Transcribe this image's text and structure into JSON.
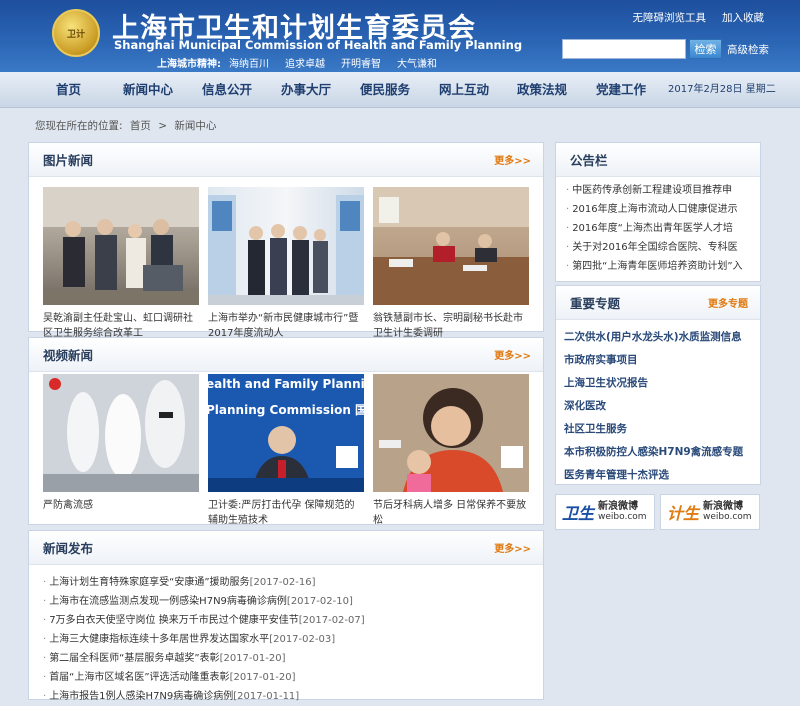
{
  "header": {
    "emblem_text": "卫计",
    "title_cn": "上海市卫生和计划生育委员会",
    "title_en": "Shanghai Municipal Commission of Health and Family Planning",
    "spirit_label": "上海城市精神:",
    "spirit_words": [
      "海纳百川",
      "追求卓越",
      "开明睿智",
      "大气谦和"
    ],
    "top_links": [
      "无障碍浏览工具",
      "加入收藏"
    ],
    "search_placeholder": "",
    "search_button": "检索",
    "advanced_search": "高级检索"
  },
  "nav": {
    "items": [
      "首页",
      "新闻中心",
      "信息公开",
      "办事大厅",
      "便民服务",
      "网上互动",
      "政策法规",
      "党建工作"
    ],
    "date": "2017年2月28日 星期二"
  },
  "breadcrumb": {
    "prefix": "您现在所在的位置:",
    "home": "首页",
    "sep": ">",
    "current": "新闻中心"
  },
  "picture_news": {
    "title": "图片新闻",
    "more": "更多>>",
    "items": [
      {
        "caption": "吴乾渝副主任赴宝山、虹口调研社区卫生服务综合改革工"
      },
      {
        "caption": "上海市举办“新市民健康城市行”暨2017年度流动人"
      },
      {
        "caption": "翁铁慧副市长、宗明副秘书长赴市卫生计生委调研"
      }
    ]
  },
  "video_news": {
    "title": "视频新闻",
    "more": "更多>>",
    "items": [
      {
        "caption": "严防禽流感"
      },
      {
        "caption": "卫计委:严厉打击代孕 保障规范的辅助生殖技术",
        "thumb_text_1": "ealth and Family Planning Co",
        "thumb_text_2": "Planning Commission 国家"
      },
      {
        "caption": "节后牙科病人增多 日常保养不要放松"
      }
    ]
  },
  "news_release": {
    "title": "新闻发布",
    "more": "更多>>",
    "items": [
      {
        "text": "上海计划生育特殊家庭享受“安康通”援助服务",
        "date": "[2017-02-16]"
      },
      {
        "text": "上海市在流感监测点发现一例感染H7N9病毒确诊病例",
        "date": "[2017-02-10]"
      },
      {
        "text": "7万多白衣天使坚守岗位 换来万千市民过个健康平安佳节",
        "date": "[2017-02-07]"
      },
      {
        "text": "上海三大健康指标连续十多年居世界发达国家水平",
        "date": "[2017-02-03]"
      },
      {
        "text": "第二届全科医师“基层服务卓越奖”表彰",
        "date": "[2017-01-20]"
      },
      {
        "text": "首届“上海市区域名医”评选活动隆重表彰",
        "date": "[2017-01-20]"
      },
      {
        "text": "上海市报告1例人感染H7N9病毒确诊病例",
        "date": "[2017-01-11]"
      }
    ]
  },
  "notice": {
    "title": "公告栏",
    "items": [
      "中医药传承创新工程建设项目推荐申",
      "2016年度上海市流动人口健康促进示",
      "2016年度“上海杰出青年医学人才培",
      "关于对2016年全国综合医院、专科医",
      "第四批“上海青年医师培养资助计划”入"
    ]
  },
  "topics": {
    "title": "重要专题",
    "more": "更多专题",
    "items": [
      "二次供水(用户水龙头水)水质监测信息",
      "市政府实事项目",
      "上海卫生状况报告",
      "深化医改",
      "社区卫生服务",
      "本市积极防控人感染H7N9禽流感专题",
      "医务青年管理十杰评选"
    ]
  },
  "weibo": [
    {
      "big": "卫生",
      "line1": "新浪微博",
      "line2": "weibo.com",
      "color": "#1a4fa3"
    },
    {
      "big": "计生",
      "line1": "新浪微博",
      "line2": "weibo.com",
      "color": "#e07a12"
    }
  ]
}
